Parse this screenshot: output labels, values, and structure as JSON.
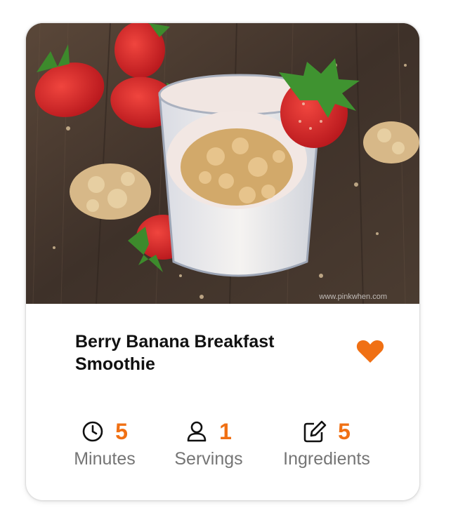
{
  "recipe": {
    "title": "Berry Banana Breakfast Smoothie",
    "image_watermark": "www.pinkwhen.com",
    "favorite_icon": "heart-icon",
    "accent_color": "#f07014"
  },
  "stats": {
    "minutes": {
      "value": "5",
      "label": "Minutes",
      "icon": "clock-icon"
    },
    "servings": {
      "value": "1",
      "label": "Servings",
      "icon": "user-icon"
    },
    "ingredients": {
      "value": "5",
      "label": "Ingredients",
      "icon": "edit-icon"
    }
  }
}
